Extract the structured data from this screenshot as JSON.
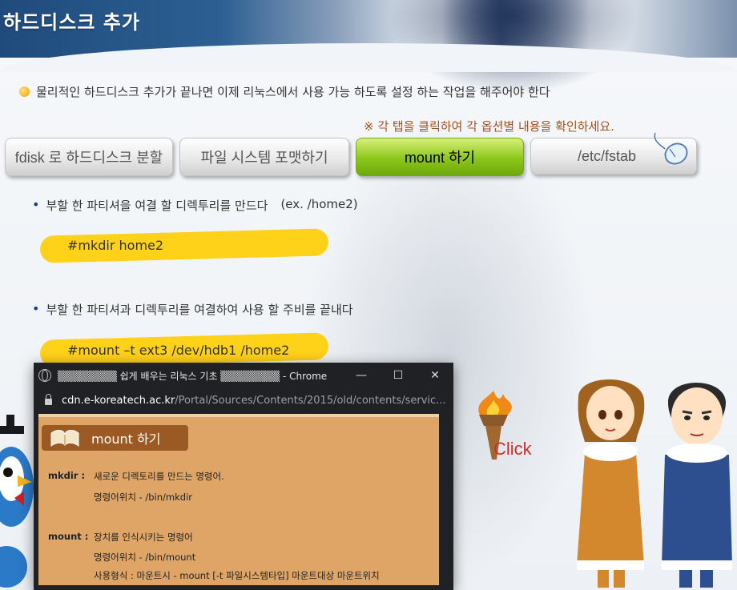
{
  "header": {
    "title": "하드디스크 추가"
  },
  "intro": {
    "text": "물리적인 하드디스크 추가가 끝나면 이제 리눅스에서 사용 가능 하도록 설정 하는 작업을 해주어야 한다"
  },
  "notice": {
    "text": "※ 각 탭을 클릭하여 각 옵션별 내용을 확인하세요."
  },
  "tabs": [
    {
      "label": "fdisk 로 하드디스크 분할",
      "active": false
    },
    {
      "label": "파일 시스템 포맷하기",
      "active": false
    },
    {
      "label": "mount 하기",
      "active": true
    },
    {
      "label": "/etc/fstab",
      "active": false
    }
  ],
  "steps": [
    {
      "text": "부할 한 파티셔을 여결 할 디렉투리를 만드다",
      "note": "(ex. /home2)",
      "command": "#mkdir home2"
    },
    {
      "text": "부할 한 파티셔과 디렉투리를 여결하여 사용 할 주비를 끝내다",
      "command": "#mount –t ext3 /dev/hdb1 /home2"
    }
  ],
  "click_label": "Click",
  "popup": {
    "window_title": "▒▒▒▒▒▒▒▒ 쉽게 배우는 리눅스 기초 ▒▒▒▒▒▒▒▒ - Chrome",
    "url_host": "cdn.e-koreatech.ac.kr",
    "url_path": "/Portal/Sources/Contents/2015/old/contents/servic...",
    "controls": {
      "minimize": "—",
      "maximize": "☐",
      "close": "✕"
    },
    "content_title": "mount 하기",
    "entries": [
      {
        "term": "mkdir :",
        "desc": "새로운 디렉토리를 만드는 명령어.",
        "location": "명령어위치 -  /bin/mkdir"
      },
      {
        "term": "mount :",
        "desc": "장치를 인식시키는 명령어",
        "location": "명령어위치 - /bin/mount",
        "usage": "사용형식 : 마운트시 - mount [-t 파일시스템타입] 마운트대상 마운트위치"
      }
    ]
  },
  "colors": {
    "active_tab": "#8cc61a",
    "highlight": "#ffd21a",
    "popup_bg": "#dfa566",
    "notice": "#a0521e"
  }
}
